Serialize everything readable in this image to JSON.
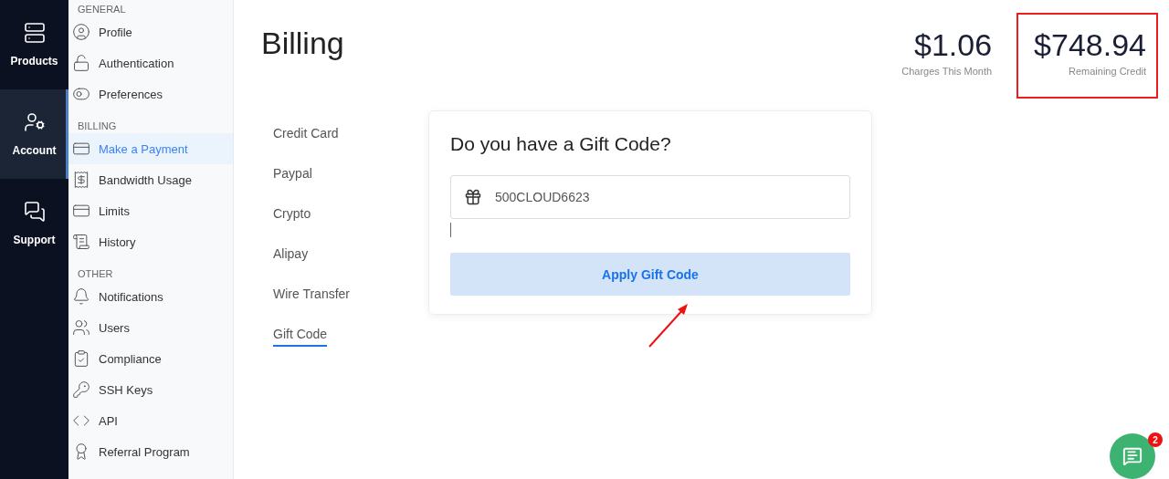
{
  "rail": [
    {
      "label": "Products",
      "selected": false
    },
    {
      "label": "Account",
      "selected": true
    },
    {
      "label": "Support",
      "selected": false
    }
  ],
  "sidebar": {
    "sections": [
      {
        "title": "GENERAL",
        "items": [
          {
            "label": "Profile",
            "selected": false
          },
          {
            "label": "Authentication",
            "selected": false
          },
          {
            "label": "Preferences",
            "selected": false
          }
        ]
      },
      {
        "title": "BILLING",
        "items": [
          {
            "label": "Make a Payment",
            "selected": true
          },
          {
            "label": "Bandwidth Usage",
            "selected": false
          },
          {
            "label": "Limits",
            "selected": false
          },
          {
            "label": "History",
            "selected": false
          }
        ]
      },
      {
        "title": "OTHER",
        "items": [
          {
            "label": "Notifications",
            "selected": false
          },
          {
            "label": "Users",
            "selected": false
          },
          {
            "label": "Compliance",
            "selected": false
          },
          {
            "label": "SSH Keys",
            "selected": false
          },
          {
            "label": "API",
            "selected": false
          },
          {
            "label": "Referral Program",
            "selected": false
          }
        ]
      }
    ]
  },
  "page": {
    "title": "Billing"
  },
  "stats": [
    {
      "value": "$1.06",
      "label": "Charges This Month",
      "highlighted": false
    },
    {
      "value": "$748.94",
      "label": "Remaining Credit",
      "highlighted": true
    }
  ],
  "payment_methods": [
    {
      "label": "Credit Card",
      "selected": false
    },
    {
      "label": "Paypal",
      "selected": false
    },
    {
      "label": "Crypto",
      "selected": false
    },
    {
      "label": "Alipay",
      "selected": false
    },
    {
      "label": "Wire Transfer",
      "selected": false
    },
    {
      "label": "Gift Code",
      "selected": true
    }
  ],
  "gift_card": {
    "heading": "Do you have a Gift Code?",
    "value": "500CLOUD6623",
    "button": "Apply Gift Code"
  },
  "chat": {
    "badge": "2"
  }
}
